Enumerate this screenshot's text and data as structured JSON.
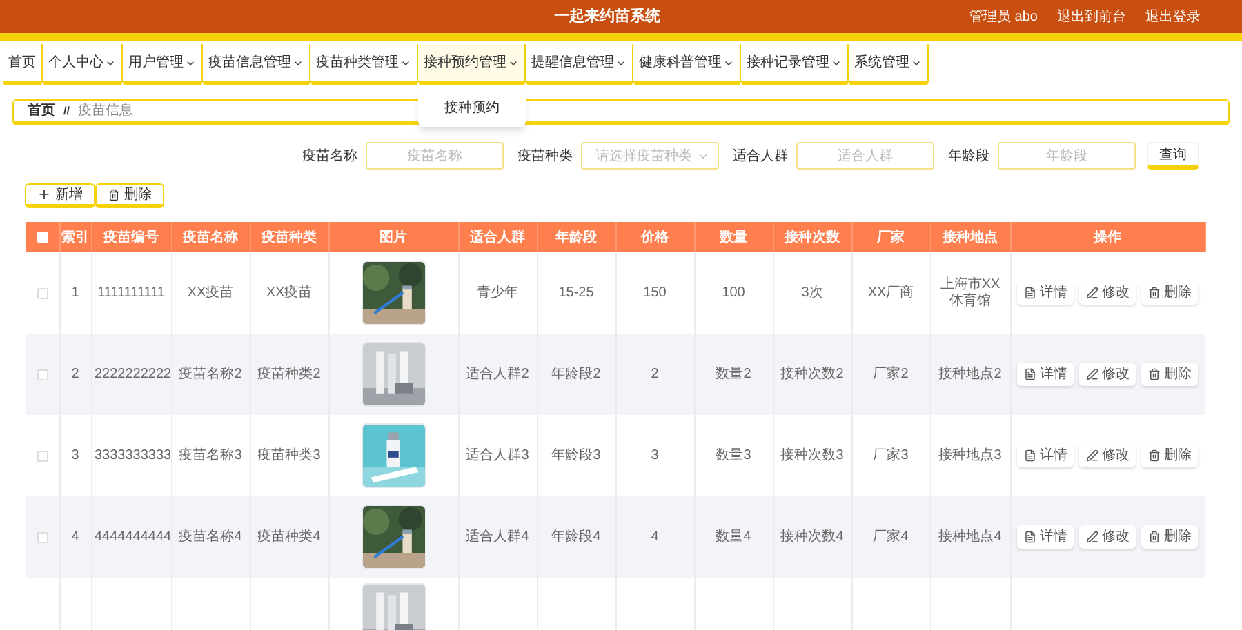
{
  "header": {
    "title": "一起来约苗系统",
    "links": [
      "管理员 abo",
      "退出到前台",
      "退出登录"
    ]
  },
  "nav": [
    {
      "label": "首页",
      "kind": "link",
      "expanded": false
    },
    {
      "label": "个人中心",
      "kind": "menu",
      "expanded": false
    },
    {
      "label": "用户管理",
      "kind": "menu",
      "expanded": false
    },
    {
      "label": "疫苗信息管理",
      "kind": "menu",
      "expanded": false
    },
    {
      "label": "疫苗种类管理",
      "kind": "menu",
      "expanded": false
    },
    {
      "label": "接种预约管理",
      "kind": "menu",
      "expanded": true,
      "children": [
        "接种预约"
      ]
    },
    {
      "label": "提醒信息管理",
      "kind": "menu",
      "expanded": false
    },
    {
      "label": "健康科普管理",
      "kind": "menu",
      "expanded": false
    },
    {
      "label": "接种记录管理",
      "kind": "menu",
      "expanded": false
    },
    {
      "label": "系统管理",
      "kind": "menu",
      "expanded": false
    }
  ],
  "breadcrumb": {
    "home": "首页",
    "separator": "//",
    "current": "疫苗信息"
  },
  "search": {
    "fields": [
      {
        "label": "疫苗名称",
        "kind": "input",
        "placeholder": "疫苗名称"
      },
      {
        "label": "疫苗种类",
        "kind": "select",
        "placeholder": "请选择疫苗种类"
      },
      {
        "label": "适合人群",
        "kind": "input",
        "placeholder": "适合人群"
      },
      {
        "label": "年龄段",
        "kind": "input",
        "placeholder": "年龄段"
      }
    ],
    "button": "查询"
  },
  "actions": [
    {
      "label": "新增",
      "kind": "add"
    },
    {
      "label": "删除",
      "kind": "delete"
    }
  ],
  "table": {
    "all_checked": false,
    "columns": [
      "索引",
      "疫苗编号",
      "疫苗名称",
      "疫苗种类",
      "图片",
      "适合人群",
      "年龄段",
      "价格",
      "数量",
      "接种次数",
      "厂家",
      "接种地点",
      "操作"
    ],
    "rows": [
      {
        "checked": false,
        "cells": [
          {
            "kind": "text",
            "text": "1"
          },
          {
            "kind": "text",
            "text": "1111111111"
          },
          {
            "kind": "text",
            "text": "XX疫苗"
          },
          {
            "kind": "text",
            "text": "XX疫苗"
          },
          {
            "kind": "picture"
          },
          {
            "kind": "text",
            "text": "青少年"
          },
          {
            "kind": "text",
            "text": "15-25"
          },
          {
            "kind": "text",
            "text": "150"
          },
          {
            "kind": "text",
            "text": "100"
          },
          {
            "kind": "text",
            "text": "3次"
          },
          {
            "kind": "text",
            "text": "XX厂商"
          },
          {
            "kind": "text",
            "text": "上海市XX体育馆"
          },
          {
            "kind": "actions",
            "buttons": [
              {
                "label": "详情",
                "kind": "detail"
              },
              {
                "label": "修改",
                "kind": "edit"
              },
              {
                "label": "删除",
                "kind": "delete"
              }
            ]
          }
        ]
      },
      {
        "checked": false,
        "cells": [
          {
            "kind": "text",
            "text": "2"
          },
          {
            "kind": "text",
            "text": "2222222222"
          },
          {
            "kind": "text",
            "text": "疫苗名称2"
          },
          {
            "kind": "text",
            "text": "疫苗种类2"
          },
          {
            "kind": "picture"
          },
          {
            "kind": "text",
            "text": "适合人群2"
          },
          {
            "kind": "text",
            "text": "年龄段2"
          },
          {
            "kind": "text",
            "text": "2"
          },
          {
            "kind": "text",
            "text": "数量2"
          },
          {
            "kind": "text",
            "text": "接种次数2"
          },
          {
            "kind": "text",
            "text": "厂家2"
          },
          {
            "kind": "text",
            "text": "接种地点2"
          },
          {
            "kind": "actions",
            "buttons": [
              {
                "label": "详情",
                "kind": "detail"
              },
              {
                "label": "修改",
                "kind": "edit"
              },
              {
                "label": "删除",
                "kind": "delete"
              }
            ]
          }
        ]
      },
      {
        "checked": false,
        "cells": [
          {
            "kind": "text",
            "text": "3"
          },
          {
            "kind": "text",
            "text": "3333333333"
          },
          {
            "kind": "text",
            "text": "疫苗名称3"
          },
          {
            "kind": "text",
            "text": "疫苗种类3"
          },
          {
            "kind": "picture"
          },
          {
            "kind": "text",
            "text": "适合人群3"
          },
          {
            "kind": "text",
            "text": "年龄段3"
          },
          {
            "kind": "text",
            "text": "3"
          },
          {
            "kind": "text",
            "text": "数量3"
          },
          {
            "kind": "text",
            "text": "接种次数3"
          },
          {
            "kind": "text",
            "text": "厂家3"
          },
          {
            "kind": "text",
            "text": "接种地点3"
          },
          {
            "kind": "actions",
            "buttons": [
              {
                "label": "详情",
                "kind": "detail"
              },
              {
                "label": "修改",
                "kind": "edit"
              },
              {
                "label": "删除",
                "kind": "delete"
              }
            ]
          }
        ]
      },
      {
        "checked": false,
        "cells": [
          {
            "kind": "text",
            "text": "4"
          },
          {
            "kind": "text",
            "text": "4444444444"
          },
          {
            "kind": "text",
            "text": "疫苗名称4"
          },
          {
            "kind": "text",
            "text": "疫苗种类4"
          },
          {
            "kind": "picture"
          },
          {
            "kind": "text",
            "text": "适合人群4"
          },
          {
            "kind": "text",
            "text": "年龄段4"
          },
          {
            "kind": "text",
            "text": "4"
          },
          {
            "kind": "text",
            "text": "数量4"
          },
          {
            "kind": "text",
            "text": "接种次数4"
          },
          {
            "kind": "text",
            "text": "厂家4"
          },
          {
            "kind": "text",
            "text": "接种地点4"
          },
          {
            "kind": "actions",
            "buttons": [
              {
                "label": "详情",
                "kind": "detail"
              },
              {
                "label": "修改",
                "kind": "edit"
              },
              {
                "label": "删除",
                "kind": "delete"
              }
            ]
          }
        ]
      }
    ]
  }
}
